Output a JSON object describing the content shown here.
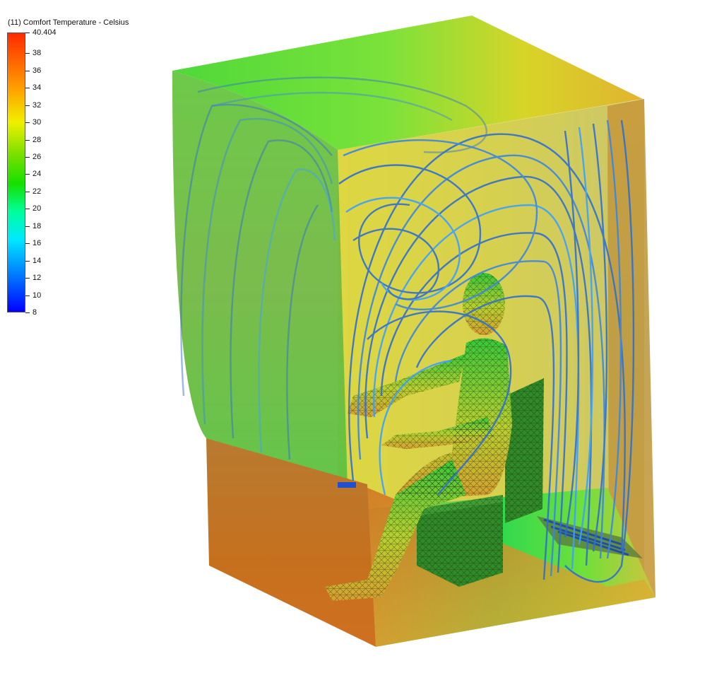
{
  "legend": {
    "title": "(11) Comfort Temperature - Celsius",
    "min": 8,
    "max": 40.404,
    "labels": [
      "40.404",
      "38",
      "36",
      "34",
      "32",
      "30",
      "28",
      "26",
      "24",
      "22",
      "20",
      "18",
      "16",
      "14",
      "12",
      "10",
      "8"
    ],
    "values": [
      40.404,
      38,
      36,
      34,
      32,
      30,
      28,
      26,
      24,
      22,
      20,
      18,
      16,
      14,
      12,
      10,
      8
    ]
  },
  "colors": {
    "streamline": "#2f6fd0",
    "streamline_light": "#3aa0ff",
    "hot": "#d44a10",
    "warm": "#e6c820",
    "cool": "#28c828"
  }
}
